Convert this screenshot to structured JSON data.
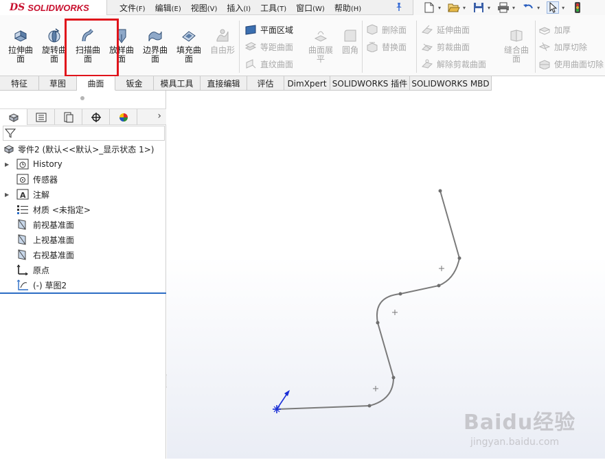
{
  "app": {
    "logo_ds": "DS",
    "brand": "SOLIDWORKS"
  },
  "menu": [
    {
      "label": "文件",
      "acc": "(F)"
    },
    {
      "label": "编辑",
      "acc": "(E)"
    },
    {
      "label": "视图",
      "acc": "(V)"
    },
    {
      "label": "插入",
      "acc": "(I)"
    },
    {
      "label": "工具",
      "acc": "(T)"
    },
    {
      "label": "窗口",
      "acc": "(W)"
    },
    {
      "label": "帮助",
      "acc": "(H)"
    }
  ],
  "ribbon": {
    "big": [
      {
        "line1": "拉伸曲",
        "line2": "面",
        "disabled": false
      },
      {
        "line1": "旋转曲",
        "line2": "面",
        "disabled": false
      },
      {
        "line1": "扫描曲",
        "line2": "面",
        "disabled": false
      },
      {
        "line1": "放样曲",
        "line2": "面",
        "disabled": false
      },
      {
        "line1": "边界曲",
        "line2": "面",
        "disabled": false
      },
      {
        "line1": "填充曲",
        "line2": "面",
        "disabled": false
      },
      {
        "line1": "自由形",
        "line2": "",
        "disabled": true
      }
    ],
    "small_col1": [
      {
        "label": "平面区域",
        "disabled": false
      },
      {
        "label": "等距曲面",
        "disabled": true
      },
      {
        "label": "直纹曲面",
        "disabled": true
      }
    ],
    "mid_big": [
      {
        "line1": "曲面展",
        "line2": "平",
        "disabled": true
      },
      {
        "line1": "圆角",
        "line2": "",
        "disabled": true
      }
    ],
    "small_col2": [
      {
        "label": "删除面",
        "disabled": true
      },
      {
        "label": "替换面",
        "disabled": true
      }
    ],
    "small_col3": [
      {
        "label": "延伸曲面",
        "disabled": true
      },
      {
        "label": "剪裁曲面",
        "disabled": true
      },
      {
        "label": "解除剪裁曲面",
        "disabled": true
      }
    ],
    "knit": {
      "line1": "缝合曲",
      "line2": "面",
      "disabled": true
    },
    "small_col4": [
      {
        "label": "加厚",
        "disabled": true
      },
      {
        "label": "加厚切除",
        "disabled": true
      },
      {
        "label": "使用曲面切除",
        "disabled": true
      }
    ]
  },
  "tabs": [
    {
      "label": "特征",
      "active": false
    },
    {
      "label": "草图",
      "active": false
    },
    {
      "label": "曲面",
      "active": true
    },
    {
      "label": "钣金",
      "active": false
    },
    {
      "label": "模具工具",
      "active": false
    },
    {
      "label": "直接编辑",
      "active": false
    },
    {
      "label": "评估",
      "active": false
    },
    {
      "label": "DimXpert",
      "active": false
    },
    {
      "label": "SOLIDWORKS 插件",
      "active": false
    },
    {
      "label": "SOLIDWORKS MBD",
      "active": false
    }
  ],
  "tree": {
    "root": "零件2  (默认<<默认>_显示状态 1>)",
    "items": [
      {
        "label": "History",
        "arrow": true
      },
      {
        "label": "传感器",
        "arrow": false
      },
      {
        "label": "注解",
        "arrow": true
      },
      {
        "label": "材质 <未指定>",
        "arrow": false
      },
      {
        "label": "前视基准面",
        "arrow": false
      },
      {
        "label": "上视基准面",
        "arrow": false
      },
      {
        "label": "右视基准面",
        "arrow": false
      },
      {
        "label": "原点",
        "arrow": false
      },
      {
        "label": "(-) 草图2",
        "arrow": false
      }
    ]
  },
  "colors": {
    "accent": "#2b6cc4",
    "highlight": "#e0141b",
    "brand": "#c8102e",
    "sketch": "#7a7a7a"
  },
  "watermark": {
    "logo": "Baidu经验",
    "url": "jingyan.baidu.com"
  }
}
